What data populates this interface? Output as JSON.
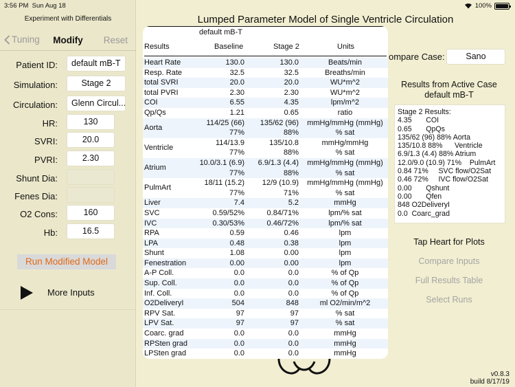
{
  "status_bar": {
    "time": "3:56 PM",
    "date": "Sun Aug 18",
    "battery": "100%"
  },
  "sidebar": {
    "app_title": "Experiment with Differentials",
    "back_label": "Tuning",
    "nav_title": "Modify",
    "reset_label": "Reset",
    "fields": [
      {
        "label": "Patient ID:",
        "value": "default mB-T"
      },
      {
        "label": "Simulation:",
        "value": "Stage 2"
      },
      {
        "label": "Circulation:",
        "value": "Glenn Circul..."
      },
      {
        "label": "HR:",
        "value": "130"
      },
      {
        "label": "SVRI:",
        "value": "20.0"
      },
      {
        "label": "PVRI:",
        "value": "2.30"
      },
      {
        "label": "Shunt Dia:",
        "value": ""
      },
      {
        "label": "Fenes Dia:",
        "value": ""
      },
      {
        "label": "O2 Cons:",
        "value": "160"
      },
      {
        "label": "Hb:",
        "value": "16.5"
      }
    ],
    "run_button": "Run Modified Model",
    "more_inputs": "More Inputs"
  },
  "main": {
    "title": "Lumped Parameter Model of Single Ventricle Circulation"
  },
  "table": {
    "case_name": "default mB-T",
    "headers": [
      "Results",
      "Baseline",
      "Stage 2",
      "Units"
    ],
    "rows": [
      {
        "name": "Heart Rate",
        "baseline": "130.0",
        "stage": "130.0",
        "units": "Beats/min"
      },
      {
        "name": "Resp. Rate",
        "baseline": "32.5",
        "stage": "32.5",
        "units": "Breaths/min"
      },
      {
        "name": "total SVRI",
        "baseline": "20.0",
        "stage": "20.0",
        "units": "WU*m^2"
      },
      {
        "name": "total PVRI",
        "baseline": "2.30",
        "stage": "2.30",
        "units": "WU*m^2"
      },
      {
        "name": "COI",
        "baseline": "6.55",
        "stage": "4.35",
        "units": "lpm/m^2"
      },
      {
        "name": "Qp/Qs",
        "baseline": "1.21",
        "stage": "0.65",
        "units": "ratio"
      },
      {
        "name": "Aorta",
        "baseline": "114/25 (66)",
        "baseline2": "77%",
        "stage": "135/62 (96)",
        "stage2": "88%",
        "units": "mmHg/mmHg (mmHg)",
        "units2": "% sat"
      },
      {
        "name": "Ventricle",
        "baseline": "114/13.9",
        "baseline2": "77%",
        "stage": "135/10.8",
        "stage2": "88%",
        "units": "mmHg/mmHg",
        "units2": "% sat"
      },
      {
        "name": "Atrium",
        "baseline": "10.0/3.1 (6.9)",
        "baseline2": "77%",
        "stage": "6.9/1.3 (4.4)",
        "stage2": "88%",
        "units": "mmHg/mmHg (mmHg)",
        "units2": "% sat"
      },
      {
        "name": "PulmArt",
        "baseline": "18/11 (15.2)",
        "baseline2": "77%",
        "stage": "12/9 (10.9)",
        "stage2": "71%",
        "units": "mmHg/mmHg (mmHg)",
        "units2": "% sat"
      },
      {
        "name": "Liver",
        "baseline": "7.4",
        "stage": "5.2",
        "units": "mmHg"
      },
      {
        "name": "SVC",
        "baseline": "0.59/52%",
        "stage": "0.84/71%",
        "units": "lpm/% sat"
      },
      {
        "name": "IVC",
        "baseline": "0.30/53%",
        "stage": "0.46/72%",
        "units": "lpm/% sat"
      },
      {
        "name": "RPA",
        "baseline": "0.59",
        "stage": "0.46",
        "units": "lpm"
      },
      {
        "name": "LPA",
        "baseline": "0.48",
        "stage": "0.38",
        "units": "lpm"
      },
      {
        "name": "Shunt",
        "baseline": "1.08",
        "stage": "0.00",
        "units": "lpm"
      },
      {
        "name": "Fenestration",
        "baseline": "0.00",
        "stage": "0.00",
        "units": "lpm"
      },
      {
        "name": "A-P Coll.",
        "baseline": "0.0",
        "stage": "0.0",
        "units": "% of Qp"
      },
      {
        "name": "Sup. Coll.",
        "baseline": "0.0",
        "stage": "0.0",
        "units": "% of Qp"
      },
      {
        "name": "Inf. Coll.",
        "baseline": "0.0",
        "stage": "0.0",
        "units": "% of Qp"
      },
      {
        "name": "O2DeliveryI",
        "baseline": "504",
        "stage": "848",
        "units": "ml O2/min/m^2"
      },
      {
        "name": "RPV Sat.",
        "baseline": "97",
        "stage": "97",
        "units": "% sat"
      },
      {
        "name": "LPV Sat.",
        "baseline": "97",
        "stage": "97",
        "units": "% sat"
      },
      {
        "name": "Coarc. grad",
        "baseline": "0.0",
        "stage": "0.0",
        "units": "mmHg"
      },
      {
        "name": "RPSten grad",
        "baseline": "0.0",
        "stage": "0.0",
        "units": "mmHg"
      },
      {
        "name": "LPSten grad",
        "baseline": "0.0",
        "stage": "0.0",
        "units": "mmHg"
      }
    ]
  },
  "right_panel": {
    "compare_label": "ompare Case:",
    "compare_value": "Sano",
    "results_title": "Results from Active Case",
    "results_case": "default mB-T",
    "results_lines": [
      "Stage 2 Results:",
      "4.35       COI",
      "0.65       QpQs",
      "135/62 (96) 88% Aorta",
      "135/10.8 88%      Ventricle",
      "6.9/1.3 (4.4) 88% Atrium",
      "12.0/9.0 (10.9) 71%    PulmArt",
      "0.84 71%     SVC flow/O2Sat",
      "0.46 72%     IVC flow/O2Sat",
      "0.00       Qshunt",
      "0.00       Qfen",
      "848 O2DeliveryI",
      "0.0  Coarc_grad"
    ],
    "tap_heart": "Tap Heart for Plots",
    "compare_inputs": "Compare Inputs",
    "full_results": "Full Results Table",
    "select_runs": "Select Runs",
    "version": "v0.8.3",
    "build": "build 8/17/19"
  }
}
